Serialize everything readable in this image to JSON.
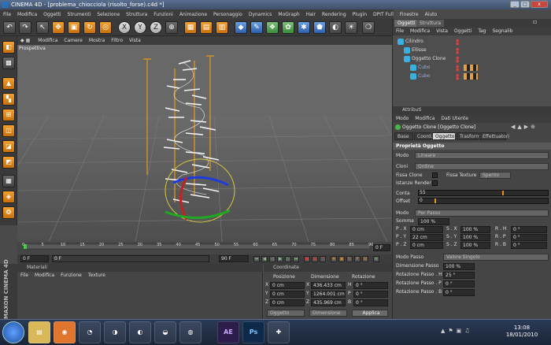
{
  "window": {
    "title": "CINEMA 4D - [problema_chiocciola (risolto_forse).c4d *]"
  },
  "menubar": [
    "File",
    "Modifica",
    "Oggetti",
    "Strumenti",
    "Selezione",
    "Struttura",
    "Funzioni",
    "Animazione",
    "Personaggio",
    "Dynamics",
    "MoGraph",
    "Hair",
    "Rendering",
    "Plugin",
    "DPIT Full",
    "Finestre",
    "Aiuto"
  ],
  "viewport": {
    "menu": [
      "Modifica",
      "Camere",
      "Mostra",
      "Filtro",
      "Vista"
    ],
    "label": "Prospettiva"
  },
  "timeline": {
    "ticks": [
      "0",
      "5",
      "10",
      "15",
      "20",
      "25",
      "30",
      "35",
      "40",
      "45",
      "50",
      "55",
      "60",
      "65",
      "70",
      "75",
      "80",
      "85",
      "90"
    ],
    "frame_field": "0 F",
    "current": "0 F",
    "start": "0 F",
    "end": "90 F"
  },
  "materials": {
    "header": "Materiali",
    "menu": [
      "File",
      "Modifica",
      "Funzione",
      "Texture"
    ]
  },
  "coords": {
    "header": "Coordinate",
    "cols": [
      "Posizione",
      "Dimensione",
      "Rotazione"
    ],
    "rows": [
      {
        "axis": "X",
        "pos": "0 cm",
        "size": "436.433 cm",
        "rlabel": "H",
        "rot": "0 °"
      },
      {
        "axis": "Y",
        "pos": "0 cm",
        "size": "1264.001 cm",
        "rlabel": "P",
        "rot": "0 °"
      },
      {
        "axis": "Z",
        "pos": "0 cm",
        "size": "435.969 cm",
        "rlabel": "B",
        "rot": "0 °"
      }
    ],
    "mode1": "Oggetto",
    "mode2": "Dimensione",
    "apply": "Applica"
  },
  "objects": {
    "tabs": [
      "Oggetti",
      "Struttura"
    ],
    "menu": [
      "File",
      "Modifica",
      "Vista",
      "Oggetti",
      "Tag",
      "Segnalib"
    ],
    "items": [
      {
        "name": "Cilindro",
        "indent": 0,
        "color": "#3ab0e0"
      },
      {
        "name": "Ellisse",
        "indent": 1,
        "color": "#3ab0e0"
      },
      {
        "name": "Oggetto Clone",
        "indent": 1,
        "color": "#3ab0e0"
      },
      {
        "name": "Cubo",
        "indent": 2,
        "color": "#3ab0e0"
      },
      {
        "name": "Cubo",
        "indent": 2,
        "color": "#3ab0e0"
      }
    ]
  },
  "attributes": {
    "header": "Attributi",
    "menu": [
      "Modo",
      "Modifica",
      "Dati Utente"
    ],
    "title": "Oggetto Clone [Oggetto Clone]",
    "tabs": [
      "Base",
      "Coord.",
      "Oggetto",
      "Trasforma",
      "Effettuatori"
    ],
    "active_tab": "Oggetto",
    "section": "Proprietà Oggetto",
    "modo_label": "Modo",
    "modo_value": "Lineare",
    "cloni_label": "Cloni",
    "cloni_value": "Ordine",
    "fissa_clone": "Fissa Clone",
    "fissa_texture": "Fissa Texture",
    "fissa_texture_value": "Spento",
    "istanze": "Istanze Render",
    "conta_label": "Conta",
    "conta_value": "55",
    "offset_label": "Offset",
    "offset_value": "0",
    "modo2_label": "Modo",
    "modo2_value": "Per Passo",
    "somma_label": "Somma",
    "somma_value": "100 %",
    "px": "0 cm",
    "py": "22 cm",
    "pz": "0 cm",
    "sx": "100 %",
    "sy": "100 %",
    "sz": "100 %",
    "rh": "0 °",
    "rp": "0 °",
    "rb": "0 °",
    "modo_passo_label": "Modo Passo",
    "modo_passo_value": "Valore Singolo",
    "dim_passo_label": "Dimensione Passo",
    "dim_passo_value": "100 %",
    "rot_h_label": "Rotazione Passo . H",
    "rot_h_value": "25 °",
    "rot_p_label": "Rotazione Passo . P",
    "rot_p_value": "0 °",
    "rot_b_label": "Rotazione Passo . B",
    "rot_b_value": "0 °"
  },
  "taskbar": {
    "time": "13:08",
    "date": "18/01/2010",
    "apps": [
      "AE",
      "Ps"
    ]
  },
  "maxon": "MAXON CINEMA 4D"
}
